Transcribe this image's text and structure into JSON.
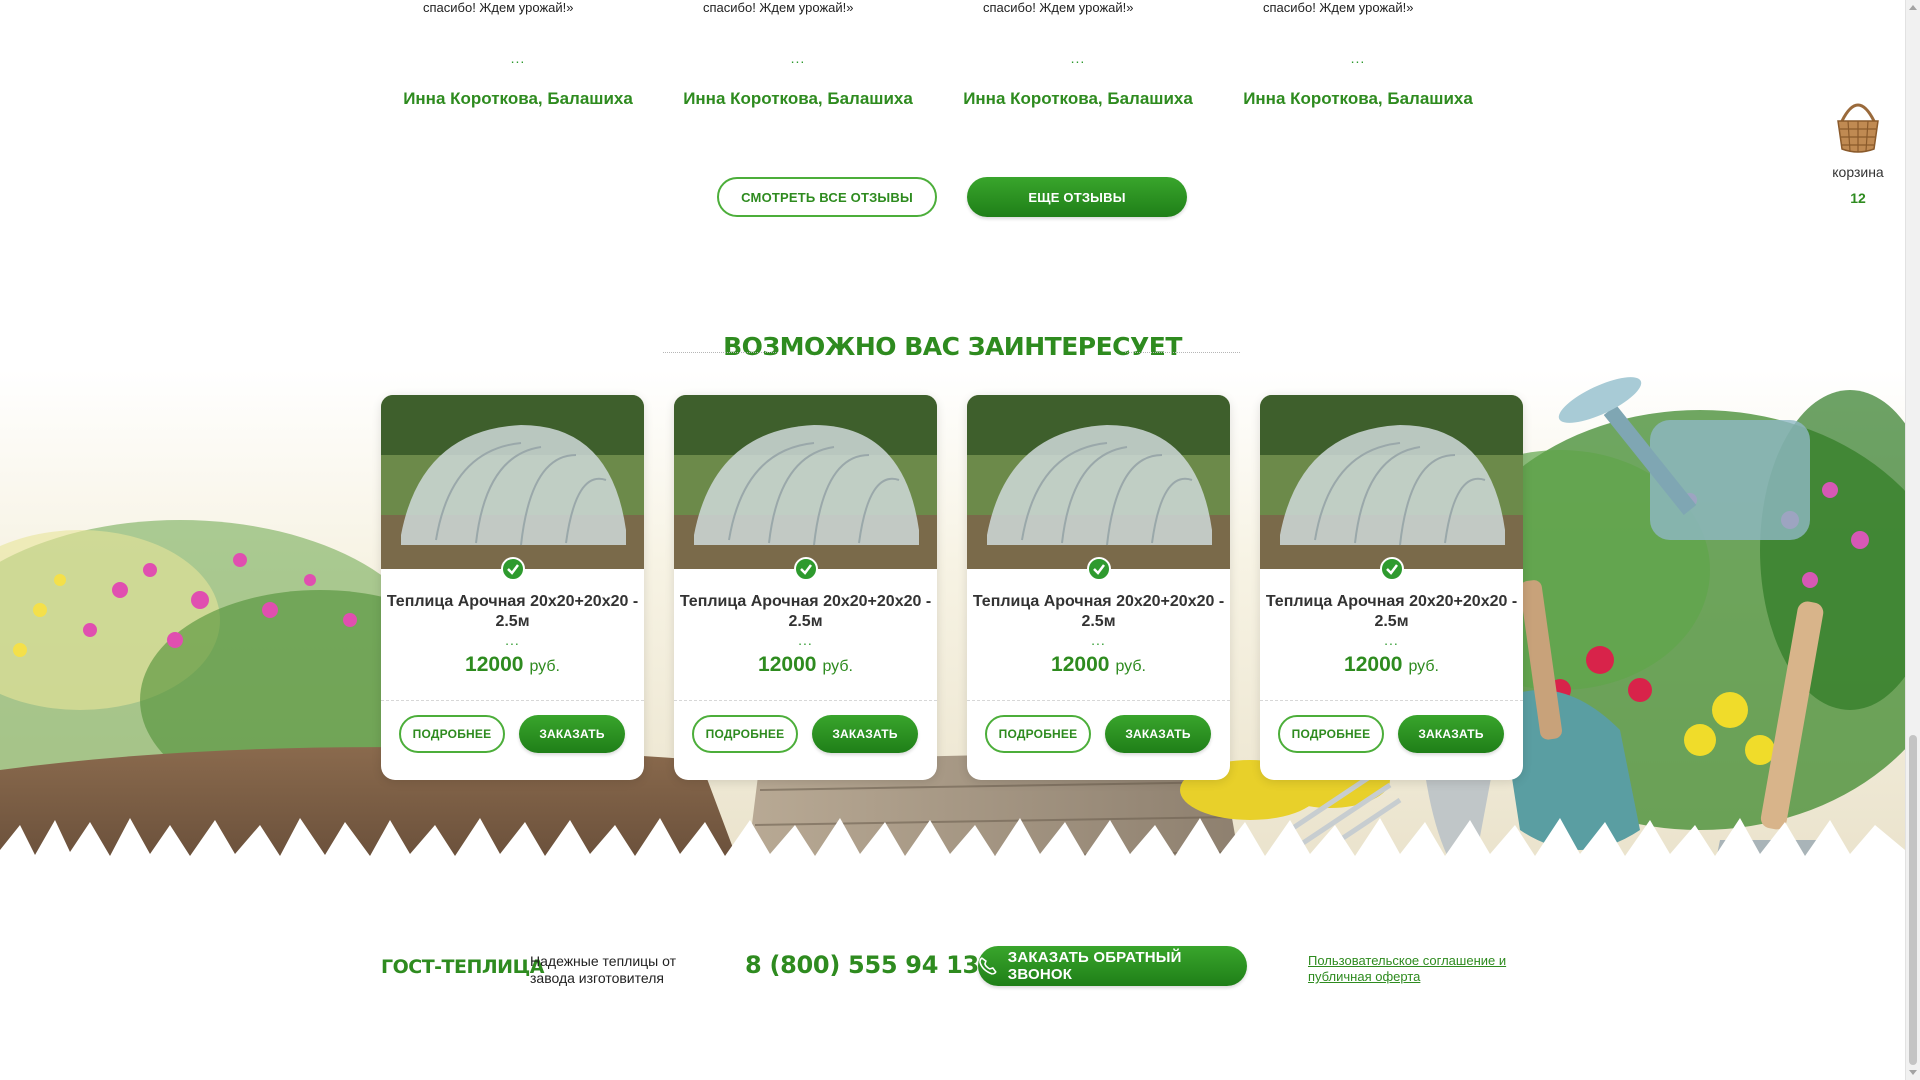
{
  "reviews": [
    {
      "quote": "спасибо! Ждем урожай!»",
      "dots": "...",
      "author": "Инна Короткова, Балашиха"
    },
    {
      "quote": "спасибо! Ждем урожай!»",
      "dots": "...",
      "author": "Инна Короткова, Балашиха"
    },
    {
      "quote": "спасибо! Ждем урожай!»",
      "dots": "...",
      "author": "Инна Короткова, Балашиха"
    },
    {
      "quote": "спасибо! Ждем урожай!»",
      "dots": "...",
      "author": "Инна Короткова, Балашиха"
    }
  ],
  "reviews_actions": {
    "all_reviews": "СМОТРЕТЬ ВСЕ ОТЗЫВЫ",
    "more_reviews": "ЕЩЕ ОТЗЫВЫ"
  },
  "cart": {
    "label": "корзина",
    "count": "12"
  },
  "section": {
    "title": "ВОЗМОЖНО ВАС ЗАИНТЕРЕСУЕТ"
  },
  "products": [
    {
      "name": "Теплица Арочная 20х20+20х20 - 2.5м",
      "dots": "...",
      "price": "12000",
      "currency": "руб.",
      "details": "ПОДРОБНЕЕ",
      "order": "ЗАКАЗАТЬ"
    },
    {
      "name": "Теплица Арочная 20х20+20х20 - 2.5м",
      "dots": "...",
      "price": "12000",
      "currency": "руб.",
      "details": "ПОДРОБНЕЕ",
      "order": "ЗАКАЗАТЬ"
    },
    {
      "name": "Теплица Арочная 20х20+20х20 - 2.5м",
      "dots": "...",
      "price": "12000",
      "currency": "руб.",
      "details": "ПОДРОБНЕЕ",
      "order": "ЗАКАЗАТЬ"
    },
    {
      "name": "Теплица Арочная 20х20+20х20 - 2.5м",
      "dots": "...",
      "price": "12000",
      "currency": "руб.",
      "details": "ПОДРОБНЕЕ",
      "order": "ЗАКАЗАТЬ"
    }
  ],
  "footer": {
    "brand": "ГОСТ-ТЕПЛИЦА",
    "tagline": "Надежные теплицы от завода изготовителя",
    "phone": "8 (800) 555 94 13",
    "callback": "ЗАКАЗАТЬ ОБРАТНЫЙ ЗВОНОК",
    "legal": "Пользовательское соглашение и публичная оферта"
  },
  "colors": {
    "brand_green": "#2e8b1f",
    "button_green": "#2a9422"
  }
}
